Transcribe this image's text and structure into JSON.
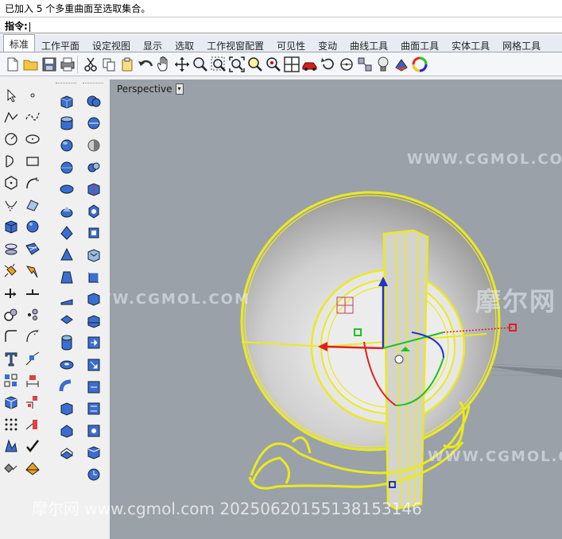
{
  "command": {
    "history_line": "已加入 5 个多重曲面至选取集合。",
    "prompt_label": "指令:"
  },
  "tabs": [
    {
      "label": "标准",
      "active": true
    },
    {
      "label": "工作平面"
    },
    {
      "label": "设定视图"
    },
    {
      "label": "显示"
    },
    {
      "label": "选取"
    },
    {
      "label": "工作视窗配置"
    },
    {
      "label": "可见性"
    },
    {
      "label": "变动"
    },
    {
      "label": "曲线工具"
    },
    {
      "label": "曲面工具"
    },
    {
      "label": "实体工具"
    },
    {
      "label": "网格工具"
    }
  ],
  "toolbar_icons": [
    "new-file-icon",
    "open-folder-icon",
    "save-icon",
    "print-icon",
    "cut-icon",
    "copy-icon",
    "paste-icon",
    "undo-icon",
    "pan-hand-icon",
    "rotate-view-icon",
    "zoom-dynamic-icon",
    "zoom-window-icon",
    "zoom-extents-icon",
    "zoom-selected-icon",
    "grid-4view-icon",
    "car-render-icon",
    "rotate-icon",
    "select-point-icon",
    "lightbulb-icon",
    "material-icon",
    "color-wheel-icon"
  ],
  "viewport": {
    "label": "Perspective",
    "dropdown_glyph": "▾"
  },
  "watermarks": {
    "cgmol_top": "WWW.CGMOL.COM",
    "cgmol_mid": "WWW.CGMOL.COM",
    "cgmol_right": "WWW.CGMOL.COM",
    "brand_cn": "摩尔网",
    "bottom": "摩尔网 www.cgmol.com 20250620155138153146"
  },
  "colors": {
    "viewport_bg": "#9aa1a8",
    "selection_yellow": "#f0f000",
    "gumball_x": "#e02020",
    "gumball_y": "#20c020",
    "gumball_z": "#2020e0"
  }
}
